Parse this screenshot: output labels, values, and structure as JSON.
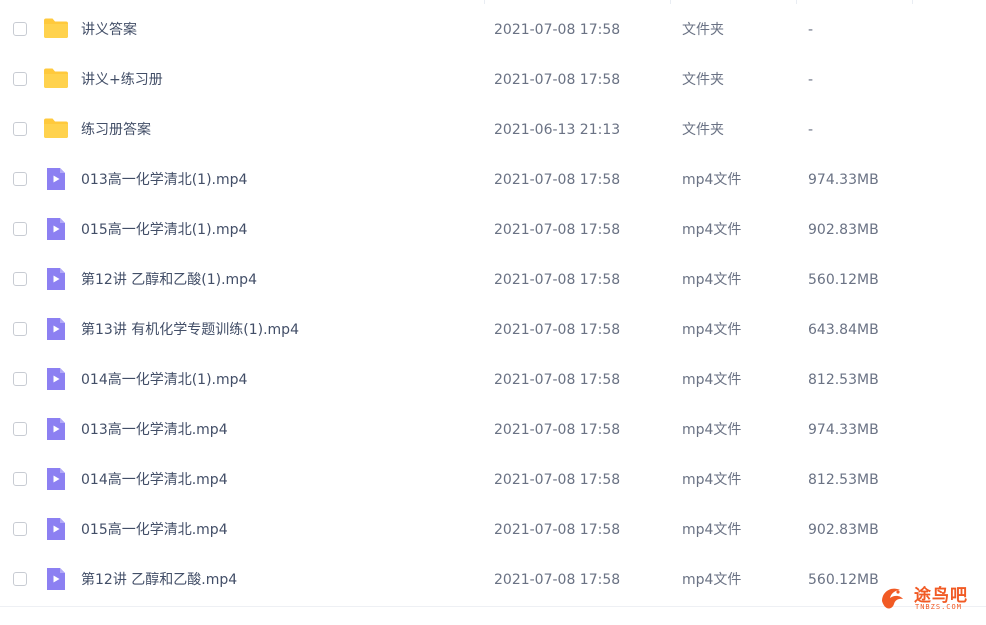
{
  "files": [
    {
      "name": "讲义答案",
      "modified": "2021-07-08 17:58",
      "type": "文件夹",
      "size": "-",
      "kind": "folder"
    },
    {
      "name": "讲义+练习册",
      "modified": "2021-07-08 17:58",
      "type": "文件夹",
      "size": "-",
      "kind": "folder"
    },
    {
      "name": "练习册答案",
      "modified": "2021-06-13 21:13",
      "type": "文件夹",
      "size": "-",
      "kind": "folder"
    },
    {
      "name": "013高一化学清北(1).mp4",
      "modified": "2021-07-08 17:58",
      "type": "mp4文件",
      "size": "974.33MB",
      "kind": "video"
    },
    {
      "name": "015高一化学清北(1).mp4",
      "modified": "2021-07-08 17:58",
      "type": "mp4文件",
      "size": "902.83MB",
      "kind": "video"
    },
    {
      "name": "第12讲 乙醇和乙酸(1).mp4",
      "modified": "2021-07-08 17:58",
      "type": "mp4文件",
      "size": "560.12MB",
      "kind": "video"
    },
    {
      "name": "第13讲 有机化学专题训练(1).mp4",
      "modified": "2021-07-08 17:58",
      "type": "mp4文件",
      "size": "643.84MB",
      "kind": "video"
    },
    {
      "name": "014高一化学清北(1).mp4",
      "modified": "2021-07-08 17:58",
      "type": "mp4文件",
      "size": "812.53MB",
      "kind": "video"
    },
    {
      "name": "013高一化学清北.mp4",
      "modified": "2021-07-08 17:58",
      "type": "mp4文件",
      "size": "974.33MB",
      "kind": "video"
    },
    {
      "name": "014高一化学清北.mp4",
      "modified": "2021-07-08 17:58",
      "type": "mp4文件",
      "size": "812.53MB",
      "kind": "video"
    },
    {
      "name": "015高一化学清北.mp4",
      "modified": "2021-07-08 17:58",
      "type": "mp4文件",
      "size": "902.83MB",
      "kind": "video"
    },
    {
      "name": "第12讲 乙醇和乙酸.mp4",
      "modified": "2021-07-08 17:58",
      "type": "mp4文件",
      "size": "560.12MB",
      "kind": "video"
    }
  ],
  "icons": {
    "folder": "folder-icon",
    "video": "video-file-icon"
  },
  "colors": {
    "folder": "#ffc93c",
    "video": "#8c80f2",
    "text": "#424e67",
    "muted": "#6a7284"
  },
  "watermark": {
    "text": "途鸟吧",
    "sub": "TNBZS.COM"
  }
}
